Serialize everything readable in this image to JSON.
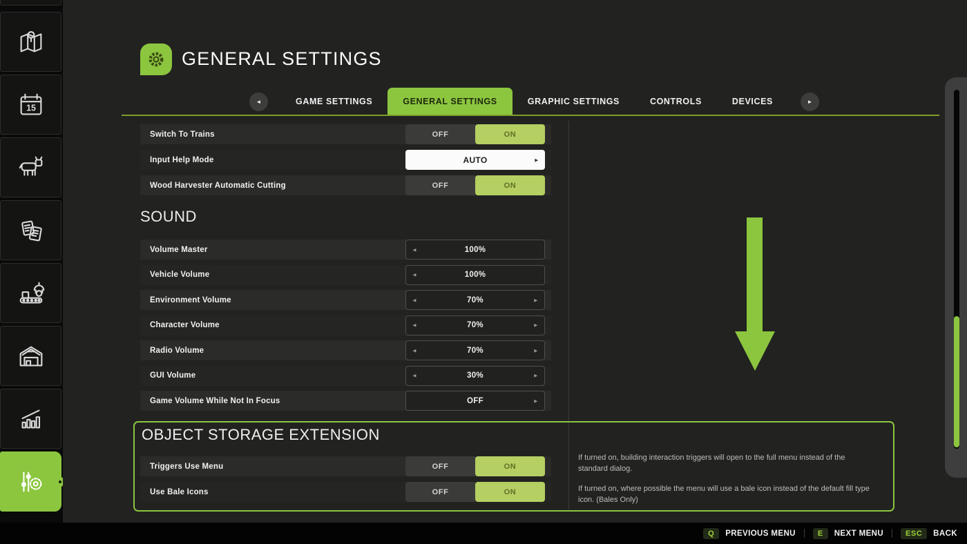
{
  "colors": {
    "accent_green": "#8cc63f",
    "toggle_on_green": "#b5cf62",
    "tab_underline": "#7d9f2b",
    "panel_background": "#222221"
  },
  "icons": {
    "prev_arrow": "◄",
    "next_arrow": "►",
    "select_left": "◄",
    "select_right": "►"
  },
  "sidebar": {
    "items": [
      "map",
      "calendar",
      "animals",
      "finances",
      "production",
      "storage",
      "statistics",
      "general-settings"
    ],
    "active_item": "general-settings",
    "calendar_day": "15"
  },
  "header": {
    "title": "GENERAL SETTINGS"
  },
  "tabs": {
    "items": [
      {
        "label": "GAME SETTINGS",
        "active": false
      },
      {
        "label": "GENERAL SETTINGS",
        "active": true
      },
      {
        "label": "GRAPHIC SETTINGS",
        "active": false
      },
      {
        "label": "CONTROLS",
        "active": false
      },
      {
        "label": "DEVICES",
        "active": false
      }
    ]
  },
  "general": {
    "rows": [
      {
        "label": "Switch To Trains",
        "type": "toggle",
        "off_label": "OFF",
        "on_label": "ON",
        "state": "ON"
      },
      {
        "label": "Input Help Mode",
        "type": "selector",
        "value": "AUTO"
      },
      {
        "label": "Wood Harvester Automatic Cutting",
        "type": "toggle",
        "off_label": "OFF",
        "on_label": "ON",
        "state": "ON"
      }
    ]
  },
  "sound": {
    "title": "SOUND",
    "rows": [
      {
        "label": "Volume Master",
        "value": "100%",
        "arrows": "left"
      },
      {
        "label": "Vehicle Volume",
        "value": "100%",
        "arrows": "left"
      },
      {
        "label": "Environment Volume",
        "value": "70%",
        "arrows": "both"
      },
      {
        "label": "Character Volume",
        "value": "70%",
        "arrows": "both"
      },
      {
        "label": "Radio Volume",
        "value": "70%",
        "arrows": "both"
      },
      {
        "label": "GUI Volume",
        "value": "30%",
        "arrows": "both"
      },
      {
        "label": "Game Volume While Not In Focus",
        "value": "OFF",
        "arrows": "right"
      }
    ]
  },
  "object_storage": {
    "title": "OBJECT STORAGE EXTENSION",
    "rows": [
      {
        "label": "Triggers Use Menu",
        "off_label": "OFF",
        "on_label": "ON",
        "state": "ON"
      },
      {
        "label": "Use Bale Icons",
        "off_label": "OFF",
        "on_label": "ON",
        "state": "ON"
      }
    ],
    "help": [
      "If turned on, building interaction triggers will open to the full menu instead of the standard dialog.",
      "If turned on, where possible the menu will use a bale icon instead of the default fill type icon. (Bales Only)"
    ]
  },
  "bottom_bar": {
    "items": [
      {
        "key": "Q",
        "label": "PREVIOUS MENU"
      },
      {
        "key": "E",
        "label": "NEXT MENU"
      },
      {
        "key": "ESC",
        "label": "BACK"
      }
    ]
  }
}
